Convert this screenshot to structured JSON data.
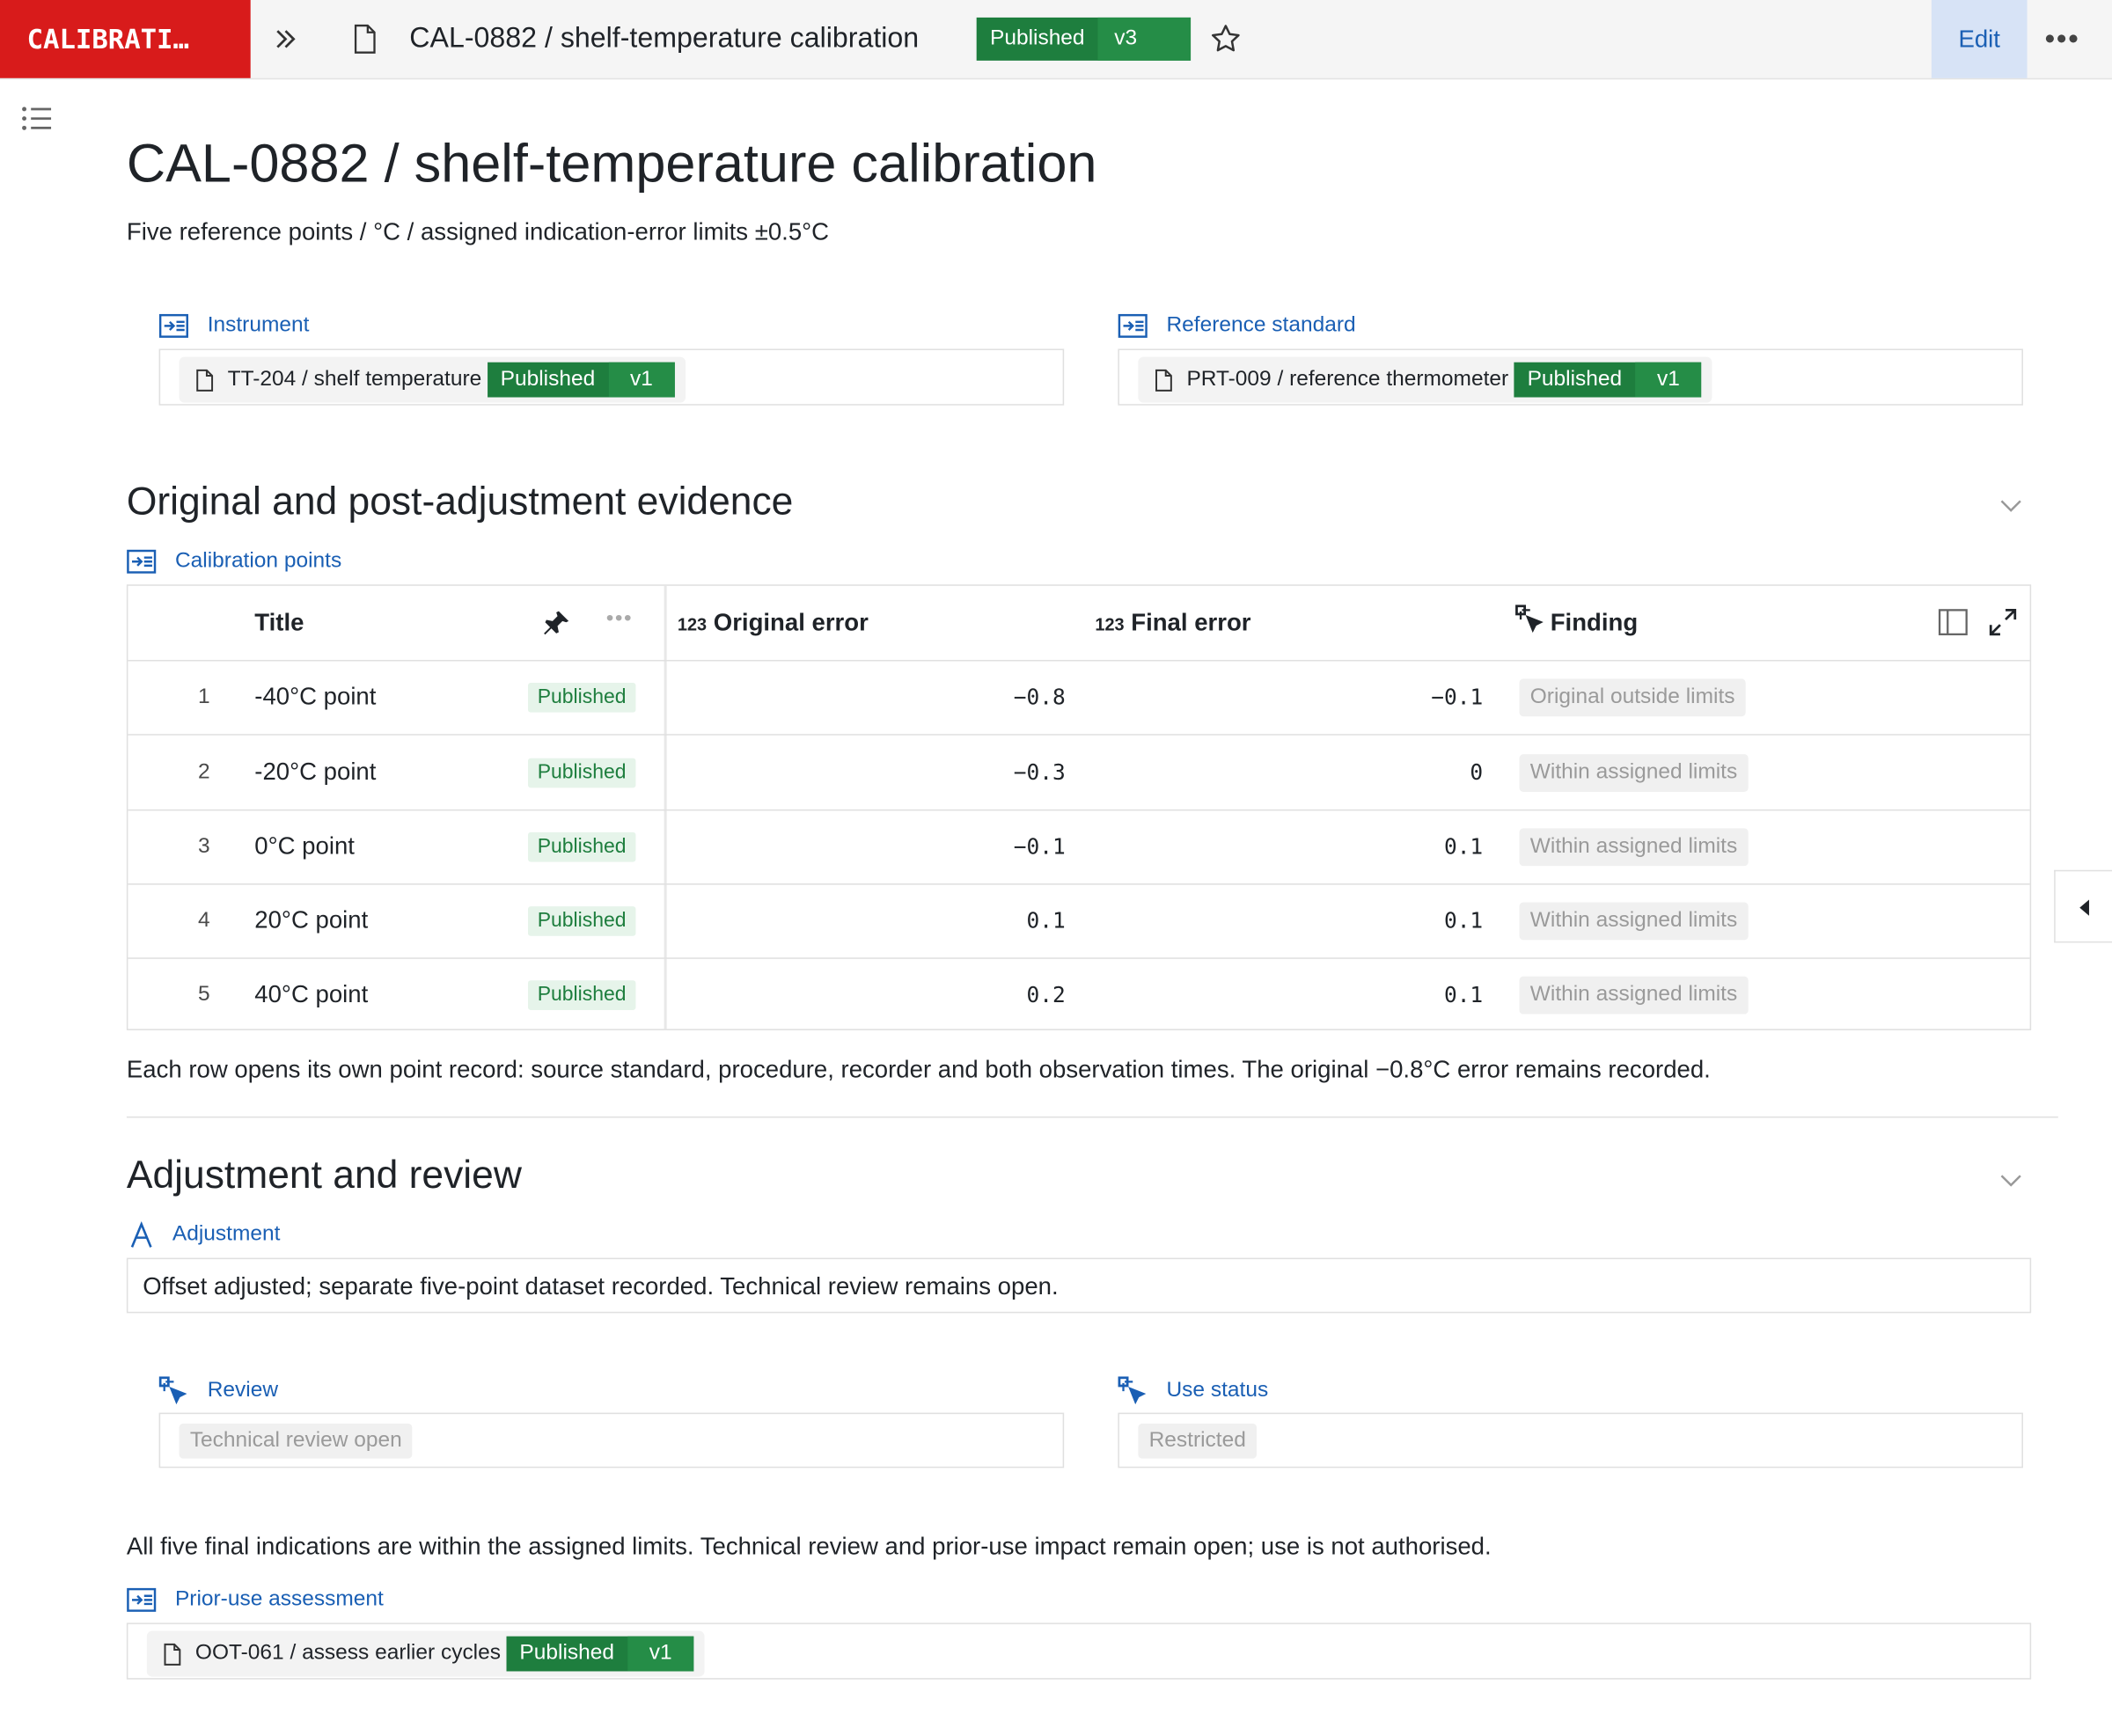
{
  "app": {
    "brand": "CALIBRATI…"
  },
  "topbar": {
    "title": "CAL-0882 / shelf-temperature calibration",
    "status": "Published",
    "version": "v3",
    "edit_label": "Edit",
    "more_label": "•••"
  },
  "page": {
    "title": "CAL-0882 / shelf-temperature calibration",
    "subtitle": "Five reference points / °C / assigned indication-error limits ±0.5°C"
  },
  "instrument": {
    "label": "Instrument",
    "ref": "TT-204 / shelf temperature",
    "status": "Published",
    "version": "v1"
  },
  "reference": {
    "label": "Reference standard",
    "ref": "PRT-009 / reference thermometer",
    "status": "Published",
    "version": "v1"
  },
  "section1": {
    "heading": "Original and post-adjustment evidence",
    "points_label": "Calibration points",
    "columns": {
      "title": "Title",
      "original_prefix": "123",
      "original": "Original error",
      "final_prefix": "123",
      "final": "Final error",
      "finding": "Finding"
    },
    "rows": [
      {
        "n": "1",
        "title": "-40°C point",
        "status": "Published",
        "original": "−0.8",
        "final": "−0.1",
        "finding": "Original outside limits"
      },
      {
        "n": "2",
        "title": "-20°C point",
        "status": "Published",
        "original": "−0.3",
        "final": "0",
        "finding": "Within assigned limits"
      },
      {
        "n": "3",
        "title": "0°C point",
        "status": "Published",
        "original": "−0.1",
        "final": "0.1",
        "finding": "Within assigned limits"
      },
      {
        "n": "4",
        "title": "20°C point",
        "status": "Published",
        "original": "0.1",
        "final": "0.1",
        "finding": "Within assigned limits"
      },
      {
        "n": "5",
        "title": "40°C point",
        "status": "Published",
        "original": "0.2",
        "final": "0.1",
        "finding": "Within assigned limits"
      }
    ],
    "note": "Each row opens its own point record: source standard, procedure, recorder and both observation times. The original −0.8°C error remains recorded."
  },
  "section2": {
    "heading": "Adjustment and review",
    "adjustment_label": "Adjustment",
    "adjustment_text": "Offset adjusted; separate five-point dataset recorded. Technical review remains open.",
    "review_label": "Review",
    "review_value": "Technical review open",
    "use_label": "Use status",
    "use_value": "Restricted",
    "summary": "All five final indications are within the assigned limits. Technical review and prior-use impact remain open; use is not authorised.",
    "prior_label": "Prior-use assessment",
    "prior_ref": "OOT-061 / assess earlier cycles",
    "prior_status": "Published",
    "prior_version": "v1"
  },
  "colors": {
    "brand": "#d81b1b",
    "published": "#1e7e3e",
    "link": "#1a5fb4",
    "edit_bg": "#d7e3f6"
  },
  "icons": [
    "chevrons-right-icon",
    "document-icon",
    "star-icon",
    "more-icon",
    "toc-icon",
    "relation-icon",
    "pin-icon",
    "column-icon",
    "expand-icon",
    "select-icon",
    "text-icon",
    "chevron-down-icon",
    "caret-left-icon"
  ]
}
